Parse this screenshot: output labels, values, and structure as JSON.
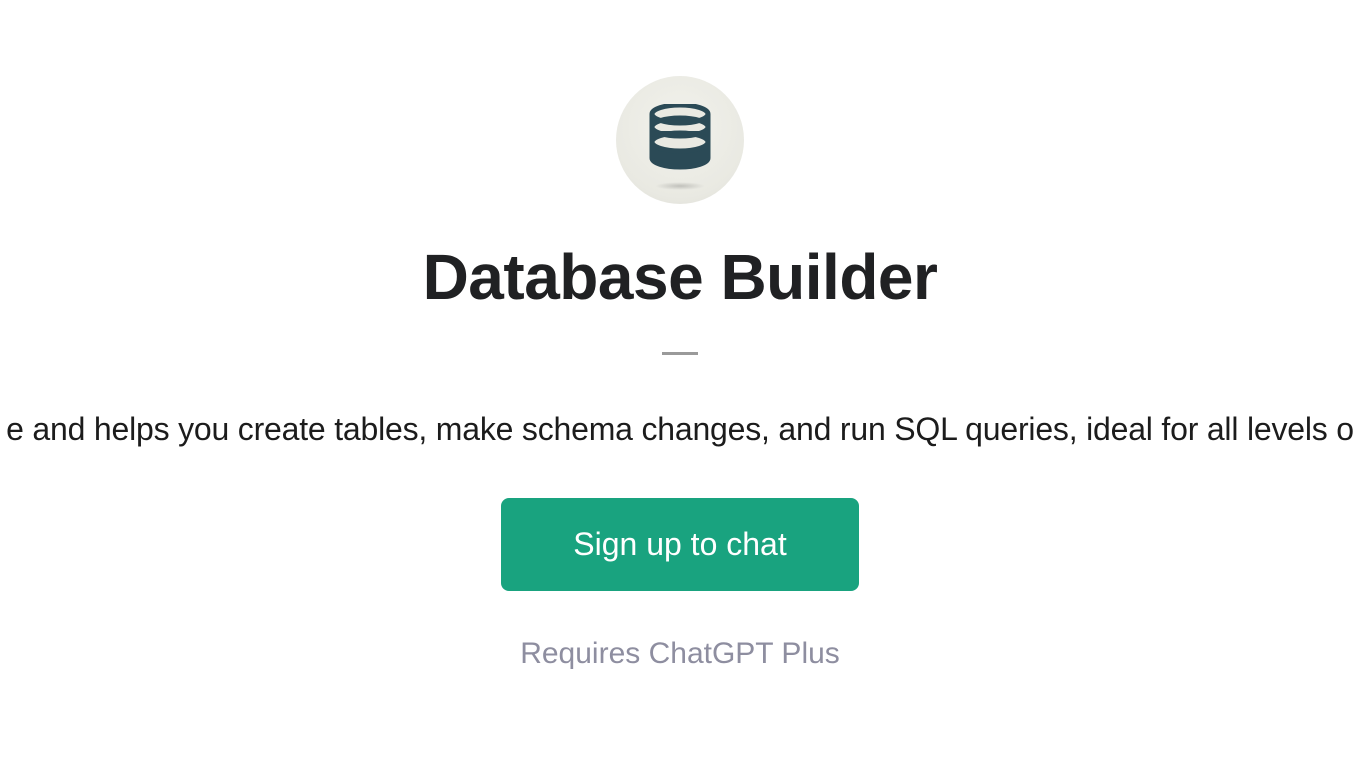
{
  "app": {
    "title": "Database Builder",
    "description": "e and helps you create tables, make schema changes, and run SQL queries, ideal for all levels o",
    "signup_label": "Sign up to chat",
    "requires_text": "Requires ChatGPT Plus"
  },
  "colors": {
    "primary": "#19a37f",
    "icon_fill": "#2b4a56"
  }
}
